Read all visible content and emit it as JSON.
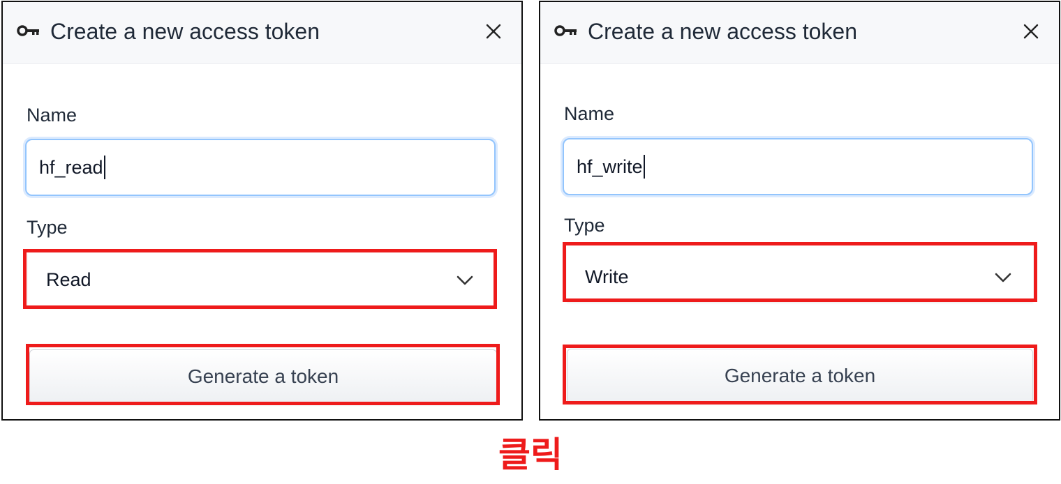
{
  "dialogs": [
    {
      "title": "Create a new access token",
      "name_label": "Name",
      "name_value": "hf_read",
      "type_label": "Type",
      "type_value": "Read",
      "generate_label": "Generate a token",
      "key_icon": "key-icon",
      "close_icon": "close-icon",
      "chevron_icon": "chevron-down-icon"
    },
    {
      "title": "Create a new access token",
      "name_label": "Name",
      "name_value": "hf_write",
      "type_label": "Type",
      "type_value": "Write",
      "generate_label": "Generate a token",
      "key_icon": "key-icon",
      "close_icon": "close-icon",
      "chevron_icon": "chevron-down-icon"
    }
  ],
  "annotation": {
    "caption": "클릭",
    "highlight_color": "#ee1b1b"
  },
  "colors": {
    "input_focus_border": "#93c5fd",
    "header_background": "#f7f8fa"
  }
}
